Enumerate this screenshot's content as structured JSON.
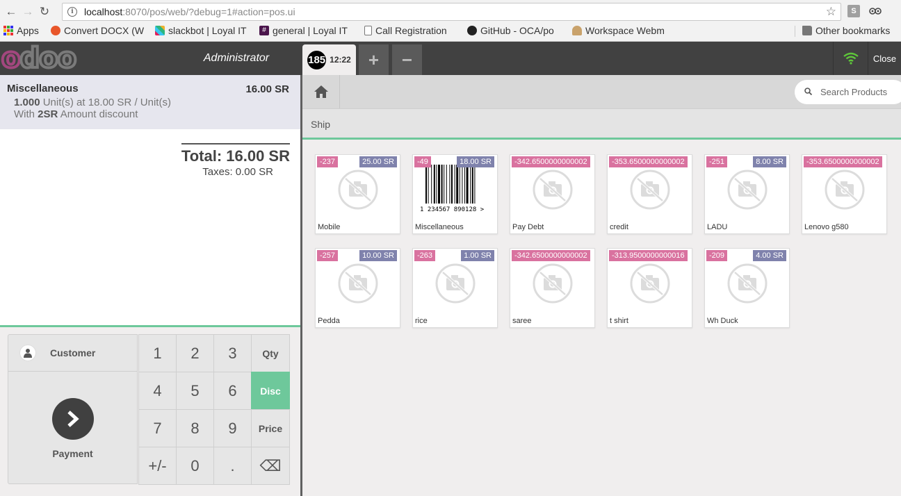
{
  "browser": {
    "url_host": "localhost",
    "url_path": ":8070/pos/web/?debug=1#action=pos.ui",
    "extensions": [
      "S",
      "tripadvisor-icon"
    ],
    "bookmarks": [
      {
        "label": "Apps",
        "icon": "apps-grid-icon"
      },
      {
        "label": "Convert DOCX (W",
        "icon": "convert-icon"
      },
      {
        "label": "slackbot | Loyal IT",
        "icon": "slack-icon"
      },
      {
        "label": "general | Loyal IT",
        "icon": "hash-icon"
      },
      {
        "label": "Call Registration",
        "icon": "page-icon"
      },
      {
        "label": "GitHub - OCA/po",
        "icon": "github-icon"
      },
      {
        "label": "Workspace Webm",
        "icon": "workspace-icon"
      }
    ],
    "other_bookmarks": "Other bookmarks"
  },
  "header": {
    "user": "Administrator",
    "order_number": "185",
    "order_time": "12:22",
    "add_label": "+",
    "remove_label": "−",
    "close_label": "Close",
    "colors": {
      "bar": "#414141",
      "accent": "#6ec89b",
      "brand": "#a2477e"
    }
  },
  "order": {
    "line": {
      "name": "Miscellaneous",
      "price": "16.00 SR",
      "qty": "1.000",
      "unit_text": "Unit(s) at 18.00 SR / Unit(s)",
      "discount_prefix": "With",
      "discount_value": "2SR",
      "discount_suffix": "Amount discount"
    },
    "total": "Total: 16.00 SR",
    "taxes": "Taxes: 0.00 SR"
  },
  "actionpad": {
    "customer": "Customer",
    "payment": "Payment"
  },
  "numpad": {
    "keys": [
      "1",
      "2",
      "3",
      "Qty",
      "4",
      "5",
      "6",
      "Disc",
      "7",
      "8",
      "9",
      "Price",
      "+/-",
      "0",
      ".",
      "⌫"
    ],
    "selected_mode": "Disc"
  },
  "products_screen": {
    "search_placeholder": "Search Products",
    "category": "Ship",
    "products": [
      {
        "name": "Mobile",
        "stock": "-237",
        "price": "25.00 SR",
        "image": "no-image-icon"
      },
      {
        "name": "Miscellaneous",
        "stock": "-49",
        "price": "18.00 SR",
        "image": "barcode",
        "barcode_digits": "1 234567 890128 >"
      },
      {
        "name": "Pay Debt",
        "stock": "-342.6500000000002",
        "price": "",
        "image": "no-image-icon"
      },
      {
        "name": "credit",
        "stock": "-353.6500000000002",
        "price": "",
        "image": "no-image-icon"
      },
      {
        "name": "LADU",
        "stock": "-251",
        "price": "8.00 SR",
        "image": "no-image-icon"
      },
      {
        "name": "Lenovo g580",
        "stock": "-353.6500000000002",
        "price": "",
        "image": "no-image-icon"
      },
      {
        "name": "Pedda",
        "stock": "-257",
        "price": "10.00 SR",
        "image": "no-image-icon"
      },
      {
        "name": "rice",
        "stock": "-263",
        "price": "1.00 SR",
        "image": "no-image-icon"
      },
      {
        "name": "saree",
        "stock": "-342.6500000000002",
        "price": "",
        "image": "no-image-icon"
      },
      {
        "name": "t shirt",
        "stock": "-313.9500000000016",
        "price": "",
        "image": "no-image-icon"
      },
      {
        "name": "Wh Duck",
        "stock": "-209",
        "price": "4.00 SR",
        "image": "no-image-icon"
      }
    ]
  }
}
